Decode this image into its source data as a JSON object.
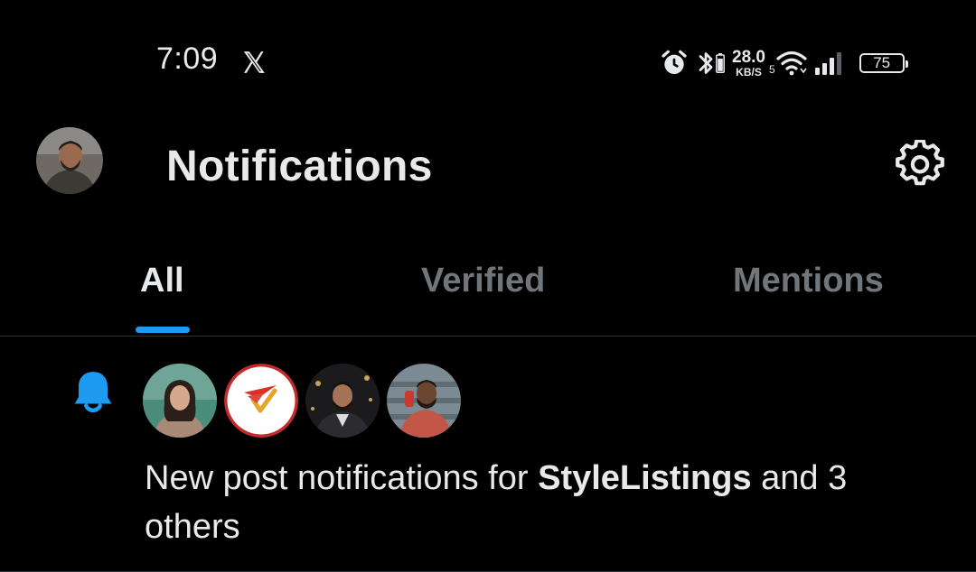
{
  "status_bar": {
    "time": "7:09",
    "app_icon": "x-logo-icon",
    "net_speed_value": "28.0",
    "net_speed_unit": "KB/S",
    "wifi_generation": "5",
    "battery_level": "75"
  },
  "header": {
    "title": "Notifications",
    "avatar_icon": "profile-avatar",
    "settings_icon": "gear-icon"
  },
  "tabs": [
    {
      "label": "All",
      "selected": true
    },
    {
      "label": "Verified",
      "selected": false
    },
    {
      "label": "Mentions",
      "selected": false
    }
  ],
  "notification": {
    "icon": "bell-icon",
    "text_prefix": "New post notifications for ",
    "bold_name": "StyleListings",
    "text_suffix": " and 3 others"
  },
  "colors": {
    "background": "#000000",
    "text_primary": "#e7e9ea",
    "text_secondary": "#71767b",
    "accent": "#1d9bf0",
    "divider": "#2f3336"
  }
}
